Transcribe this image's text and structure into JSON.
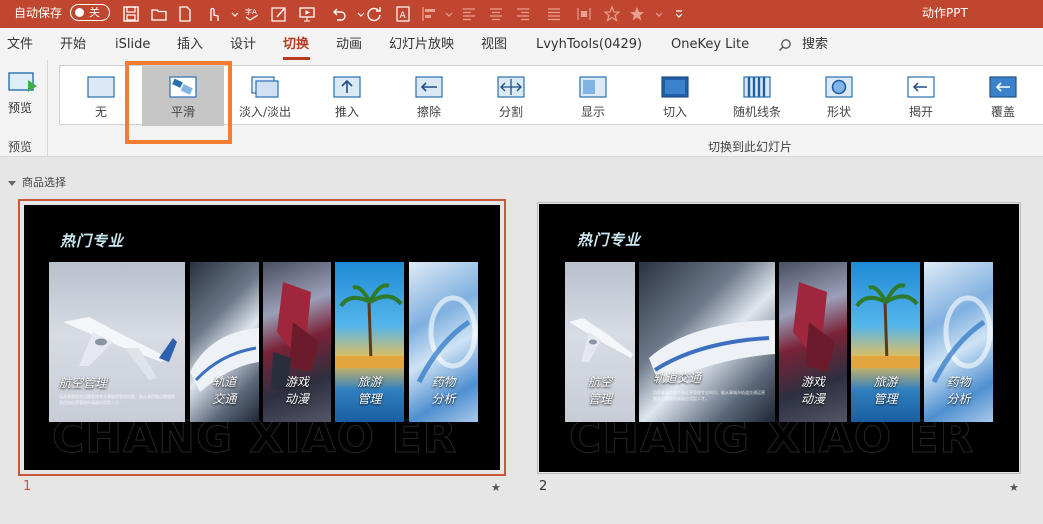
{
  "titlebar": {
    "autosave_label": "自动保存",
    "autosave_state": "关",
    "doc_title": "动作PPT"
  },
  "colors": {
    "brand": "#c0462f",
    "accent_underline": "#b83a20",
    "highlight": "#f47d30",
    "selected_slide_border": "#c75a3a"
  },
  "tabs": [
    {
      "label": "文件"
    },
    {
      "label": "开始"
    },
    {
      "label": "iSlide"
    },
    {
      "label": "插入"
    },
    {
      "label": "设计"
    },
    {
      "label": "切换"
    },
    {
      "label": "动画"
    },
    {
      "label": "幻灯片放映"
    },
    {
      "label": "视图"
    },
    {
      "label": "LvyhTools(0429)"
    },
    {
      "label": "OneKey Lite"
    },
    {
      "label": "搜索"
    }
  ],
  "ribbon": {
    "preview_label": "预览",
    "preview_group_label": "预览",
    "transition_group_label": "切换到此幻灯片",
    "effects": [
      {
        "label": "无",
        "icon": "none-transition-icon"
      },
      {
        "label": "平滑",
        "icon": "morph-transition-icon",
        "selected": true
      },
      {
        "label": "淡入/淡出",
        "icon": "fade-transition-icon"
      },
      {
        "label": "推入",
        "icon": "push-transition-icon"
      },
      {
        "label": "擦除",
        "icon": "wipe-transition-icon"
      },
      {
        "label": "分割",
        "icon": "split-transition-icon"
      },
      {
        "label": "显示",
        "icon": "reveal-transition-icon"
      },
      {
        "label": "切入",
        "icon": "cut-transition-icon"
      },
      {
        "label": "随机线条",
        "icon": "random-bars-transition-icon"
      },
      {
        "label": "形状",
        "icon": "shape-transition-icon"
      },
      {
        "label": "揭开",
        "icon": "uncover-transition-icon"
      },
      {
        "label": "覆盖",
        "icon": "cover-transition-icon"
      }
    ]
  },
  "section": {
    "name": "商品选择"
  },
  "slides": [
    {
      "number": "1",
      "title": "热门专业",
      "watermark": "CHANG XIAO ER",
      "cards": [
        {
          "title": "航空管理",
          "desc": "培养掌握航空运输管理专业基础和管理技能，能从事民航运输服务及民航经营管理的高级应用型人才。"
        },
        {
          "title": "轨道\n交通"
        },
        {
          "title": "游戏\n动漫"
        },
        {
          "title": "旅游\n管理"
        },
        {
          "title": "药物\n分析"
        }
      ]
    },
    {
      "number": "2",
      "title": "热门专业",
      "watermark": "CHANG XIAO ER",
      "cards": [
        {
          "title": "航空\n管理"
        },
        {
          "title": "轨道交通",
          "desc": "培养掌握轨道交通运营管理专业知识，能从事城市轨道交通运营服务与管理的高级应用型人才。"
        },
        {
          "title": "游戏\n动漫"
        },
        {
          "title": "旅游\n管理"
        },
        {
          "title": "药物\n分析"
        }
      ]
    }
  ]
}
